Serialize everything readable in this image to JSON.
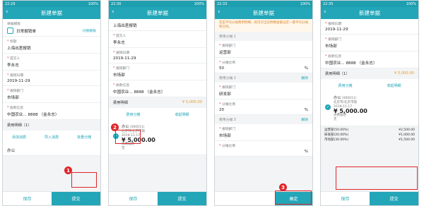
{
  "status": {
    "time": [
      "22:29",
      "22:30",
      "22:33",
      "22:35"
    ],
    "battery": "100%"
  },
  "title": "新建单据",
  "buttons": {
    "save": "保存",
    "submit": "提交",
    "confirm": "确定"
  },
  "screen1": {
    "template_label": "单据模板",
    "template_value": "日常报销单",
    "template_link": "切换模板",
    "title_label": "标题",
    "title_value": "上海出差报销",
    "person_label": "提交人",
    "person_value": "李永志",
    "date_label": "报销日期",
    "date_value": "2019-11-29",
    "dept_label": "报销部门",
    "dept_value": "市场部",
    "account_label": "收款信息",
    "account_value": "中国农业... 8888 （金永志）",
    "details_label": "费用明细（1）",
    "actions": [
      "添加消费",
      "导入消费",
      "批量分摊"
    ],
    "item_preview": "办公"
  },
  "screen2": {
    "title_value": "上海出差报销",
    "person_label": "提交人",
    "person_value": "李永志",
    "date_label": "报销日期",
    "date_value": "2019-11-29",
    "dept_label": "报销部门",
    "dept_value": "市场部",
    "account_label": "收款信息",
    "account_value": "中国农业... 8888 （金永志）",
    "details_label": "费用明细",
    "details_amount": "¥ 5,000.00",
    "actions": [
      "费用分摊",
      "收起明细"
    ],
    "item_title": "办公",
    "item_code": "(000011)",
    "item_sub": "北京市/北京市辖",
    "item_date": "2019-11-17",
    "item_amount": "¥ 5,000.00",
    "item_note1": "消费描述",
    "item_note2": "无"
  },
  "screen3": {
    "notice": "若是平均分摊费用明细，则可对当前明细金额设定一键平均分摊和比例。",
    "groups": [
      {
        "name": "费用分摊 1",
        "dept_label": "报销部门",
        "dept_value": "运营部",
        "ratio_label": "分摊比例",
        "ratio_value": "50"
      },
      {
        "name": "费用分摊 2",
        "dept_label": "报销部门",
        "dept_value": "研发部",
        "ratio_label": "分摊比例",
        "ratio_value": "20"
      },
      {
        "name": "费用分摊 3",
        "dept_label": "报销部门",
        "dept_value": "市场部",
        "ratio_label": "分摊比例",
        "ratio_value": ""
      }
    ],
    "delete": "删除",
    "pct": "%"
  },
  "screen4": {
    "date_label": "报销日期",
    "date_value": "2019-11-29",
    "dept_label": "报销部门",
    "dept_value": "市场部",
    "account_label": "收款信息",
    "account_value": "中国农业... 8888 （金永志）",
    "details_label": "费用明细（1）",
    "details_amount": "¥ 5,000.00",
    "actions": [
      "费用分摊",
      "收起明细"
    ],
    "item_title": "办公",
    "item_code": "(000011)",
    "item_sub": "北京市/北京市辖",
    "item_date": "2019-11-17",
    "item_amount": "¥ 5,000.00",
    "item_note1": "消费描述",
    "item_note2": "无",
    "allocations": [
      {
        "name": "运营部(50.00%)",
        "amount": "¥2,500.00"
      },
      {
        "name": "研发部(20.00%)",
        "amount": "¥1,000.00"
      },
      {
        "name": "市场部(30.00%)",
        "amount": "¥1,500.00"
      }
    ]
  },
  "badges": [
    "1",
    "2",
    "3"
  ]
}
